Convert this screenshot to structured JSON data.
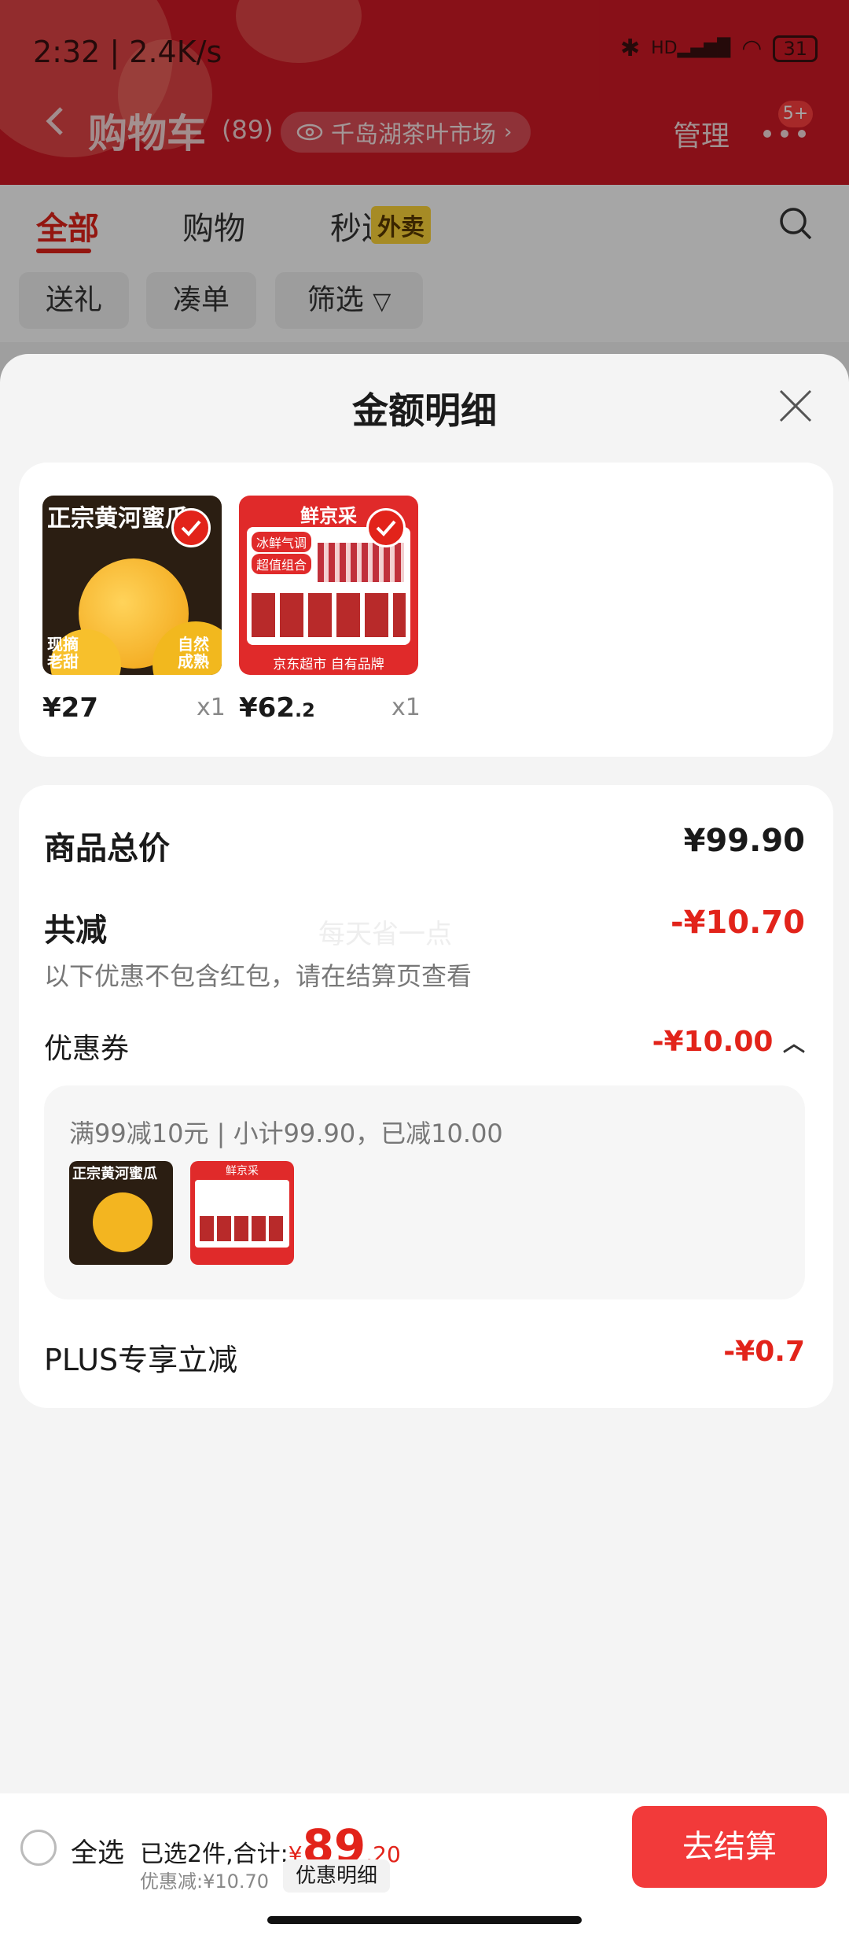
{
  "status": {
    "time": "2:32 | 2.4K/s",
    "battery": "31",
    "network": "HD"
  },
  "header": {
    "title": "购物车",
    "count": "(89)",
    "location": "千岛湖茶叶市场",
    "manage": "管理",
    "badge": "5+"
  },
  "tabs": [
    {
      "label": "全部"
    },
    {
      "label": "购物"
    },
    {
      "label": "秒送"
    }
  ],
  "waimai_tag": "外卖",
  "filters": [
    {
      "label": "送礼"
    },
    {
      "label": "凑单"
    },
    {
      "label": "筛选"
    }
  ],
  "sheet": {
    "title": "金额明细",
    "items": [
      {
        "price": "¥27",
        "qty": "x1",
        "thumb_title": "正宗黄河蜜瓜",
        "thumb_sub1": "现摘老甜",
        "thumb_sub2": "自然成熟"
      },
      {
        "price_main": "¥62",
        "price_dec": ".2",
        "qty": "x1",
        "thumb_title": "鲜京采",
        "thumb_tag1": "冰鲜气调",
        "thumb_tag2": "超值组合",
        "thumb_footer": "京东超市 自有品牌"
      }
    ],
    "total_label": "商品总价",
    "total_value": "¥99.90",
    "discount_label": "共减",
    "discount_value": "-¥10.70",
    "discount_note": "以下优惠不包含红包，请在结算页查看",
    "watermark": "每天省一点",
    "coupon_label": "优惠券",
    "coupon_value": "-¥10.00",
    "coupon_detail": "满99减10元 | 小计99.90，已减10.00",
    "plus_label": "PLUS专享立减",
    "plus_value": "-¥0.7"
  },
  "bottom": {
    "select_all": "全选",
    "summary": "已选2件,合计:",
    "currency": "¥",
    "amount_int": "89",
    "amount_dec": ".20",
    "saved": "优惠减:¥10.70",
    "detail_btn": "优惠明细",
    "checkout": "去结算"
  },
  "colors": {
    "accent": "#e2231a",
    "header": "#d11a25",
    "checkout": "#f23a3a"
  }
}
